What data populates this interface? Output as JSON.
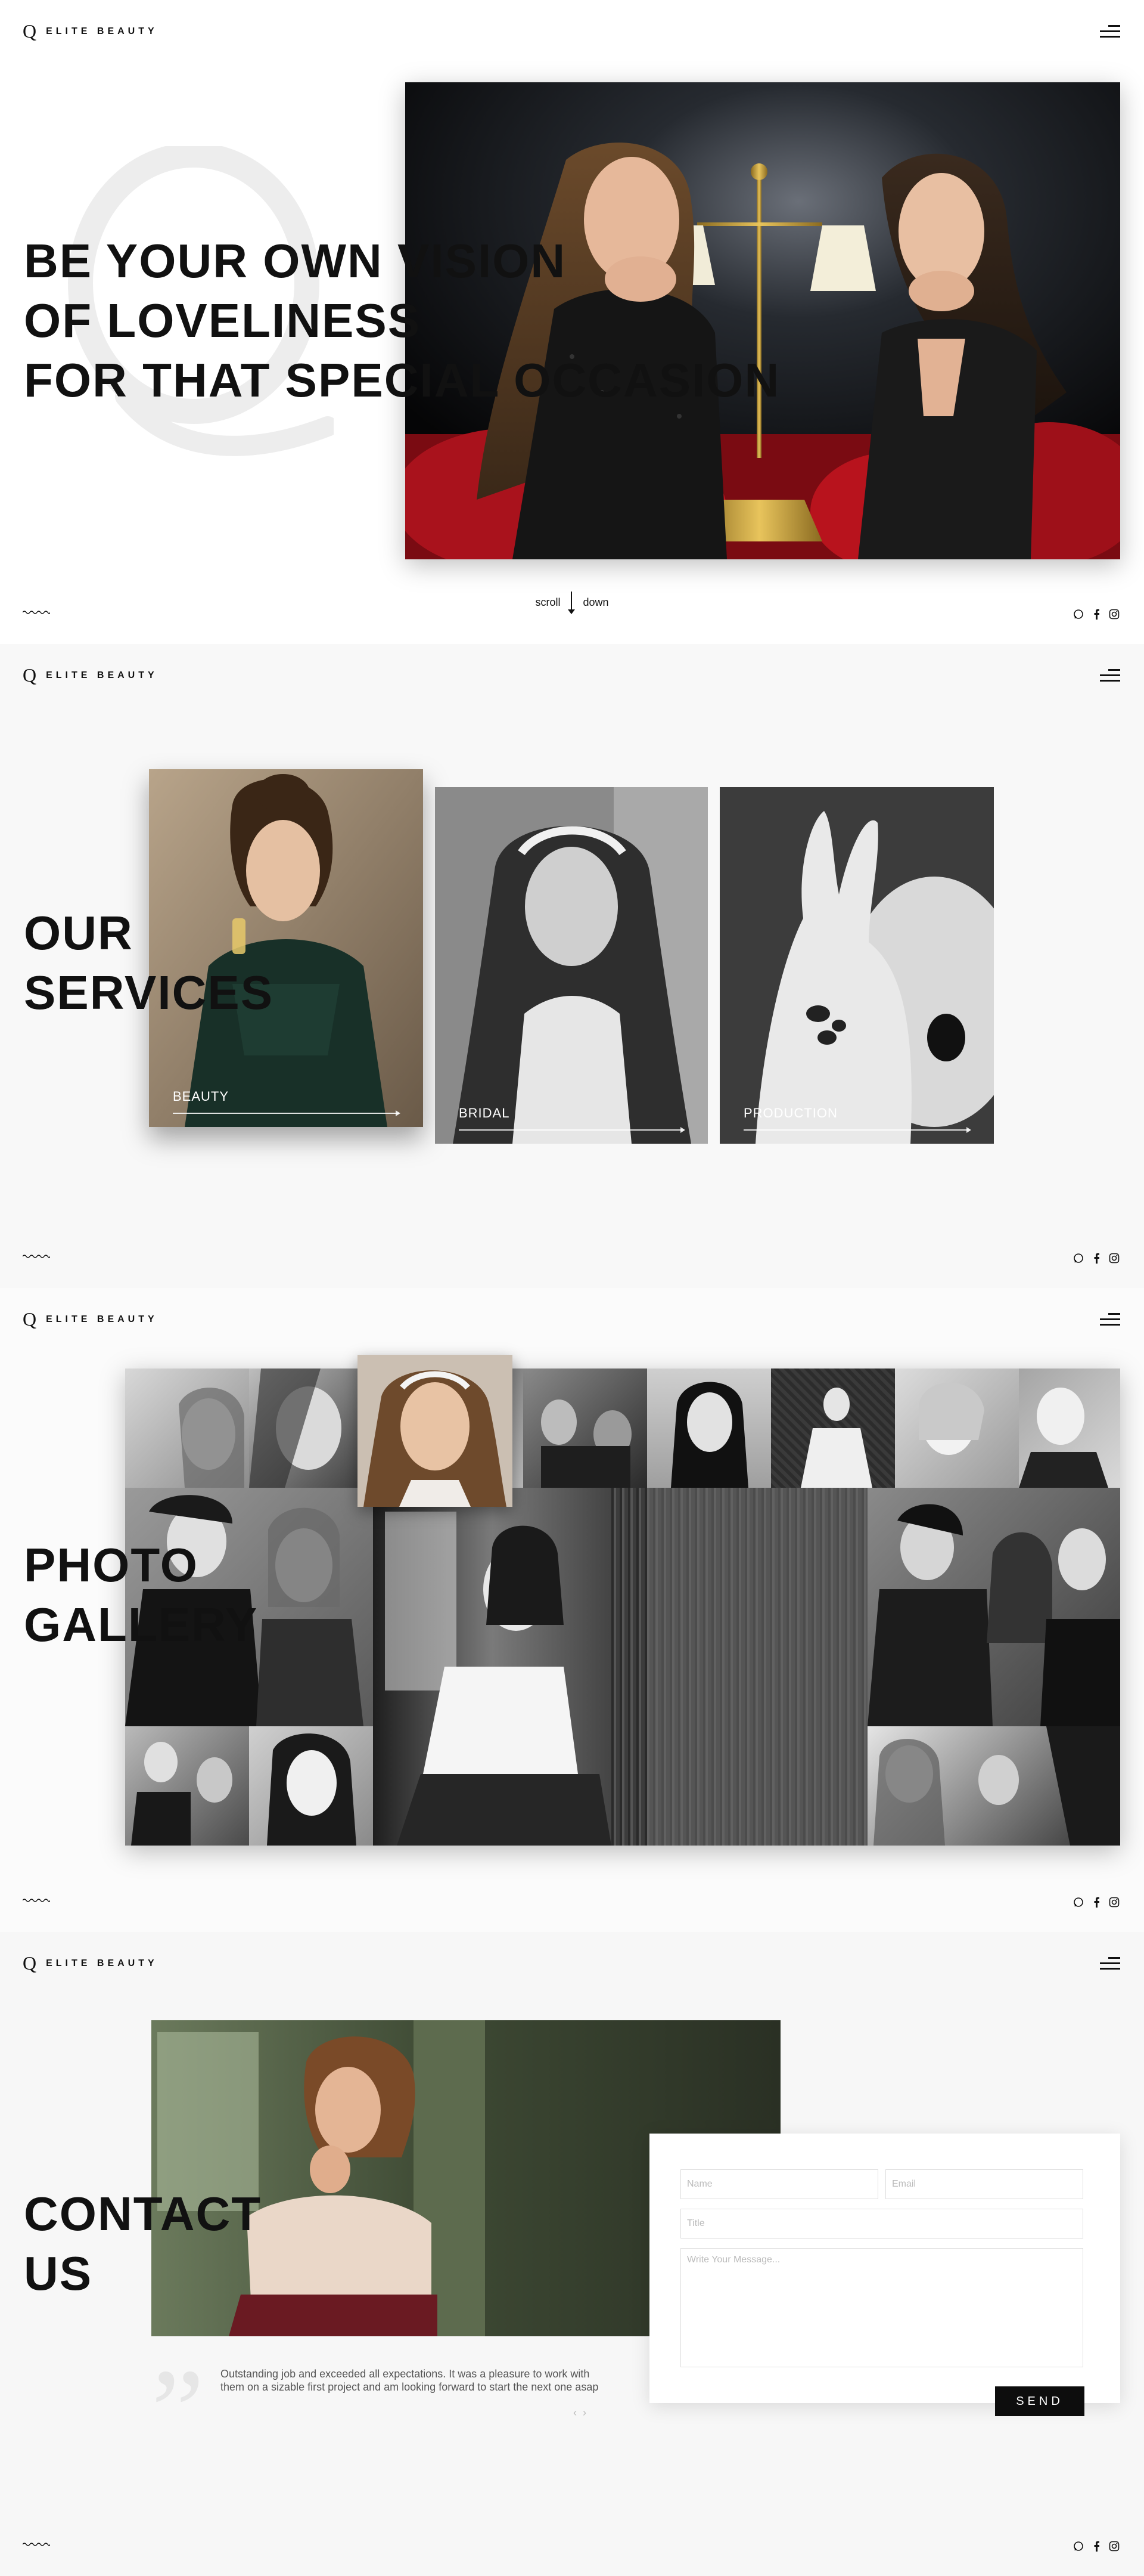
{
  "brand": {
    "logo_letter": "Q",
    "name": "ELITE BEAUTY"
  },
  "hero": {
    "title_lines": [
      "BE YOUR OWN VISION",
      "OF LOVELINESS",
      "FOR THAT SPECIAL OCCASION"
    ],
    "scroll_left": "scroll",
    "scroll_right": "down"
  },
  "services": {
    "title_lines": [
      "OUR",
      "SERVICES"
    ],
    "items": [
      {
        "label": "BEAUTY"
      },
      {
        "label": "BRIDAL"
      },
      {
        "label": "PRODUCTION"
      }
    ]
  },
  "gallery": {
    "title_lines": [
      "PHOTO",
      "GALLERY"
    ]
  },
  "contact": {
    "title_lines": [
      "CONTACT",
      "US"
    ],
    "form": {
      "name_placeholder": "Name",
      "email_placeholder": "Email",
      "title_placeholder": "Title",
      "message_placeholder": "Write Your Message...",
      "send_label": "SEND"
    },
    "testimonial": "Outstanding job and exceeded all expectations. It was a pleasure to work with them on a sizable first project and am looking forward to start the next one asap",
    "pager": [
      "‹",
      "›"
    ]
  },
  "social_icons": [
    "whatsapp-icon",
    "facebook-icon",
    "instagram-icon"
  ],
  "colors": {
    "text": "#111111",
    "accent_red": "#b3121c",
    "button": "#0d0d0d"
  }
}
